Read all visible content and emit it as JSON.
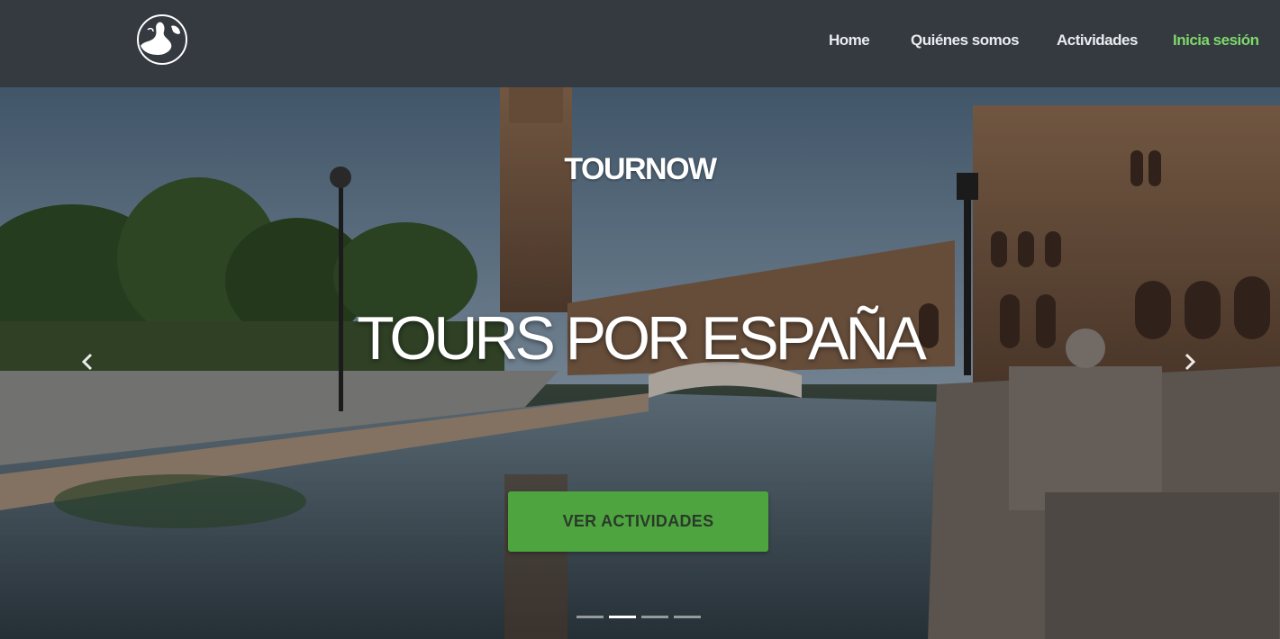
{
  "brand": {
    "logo_icon": "globe-island-icon"
  },
  "nav": {
    "items": [
      {
        "label": "Home"
      },
      {
        "label": "Quiénes somos"
      },
      {
        "label": "Actividades"
      },
      {
        "label": "Inicia sesión"
      }
    ]
  },
  "hero": {
    "subtitle": "TOURNOW",
    "title": "TOURS POR ESPAÑA",
    "cta_label": "VER ACTIVIDADES",
    "prev_icon": "chevron-left-icon",
    "next_icon": "chevron-right-icon",
    "slides_total": 4,
    "active_slide": 2
  },
  "colors": {
    "navbar_bg": "#343a40",
    "nav_text": "#e9ecef",
    "login_text": "#7fd86a",
    "cta_bg": "#4ea53f"
  }
}
